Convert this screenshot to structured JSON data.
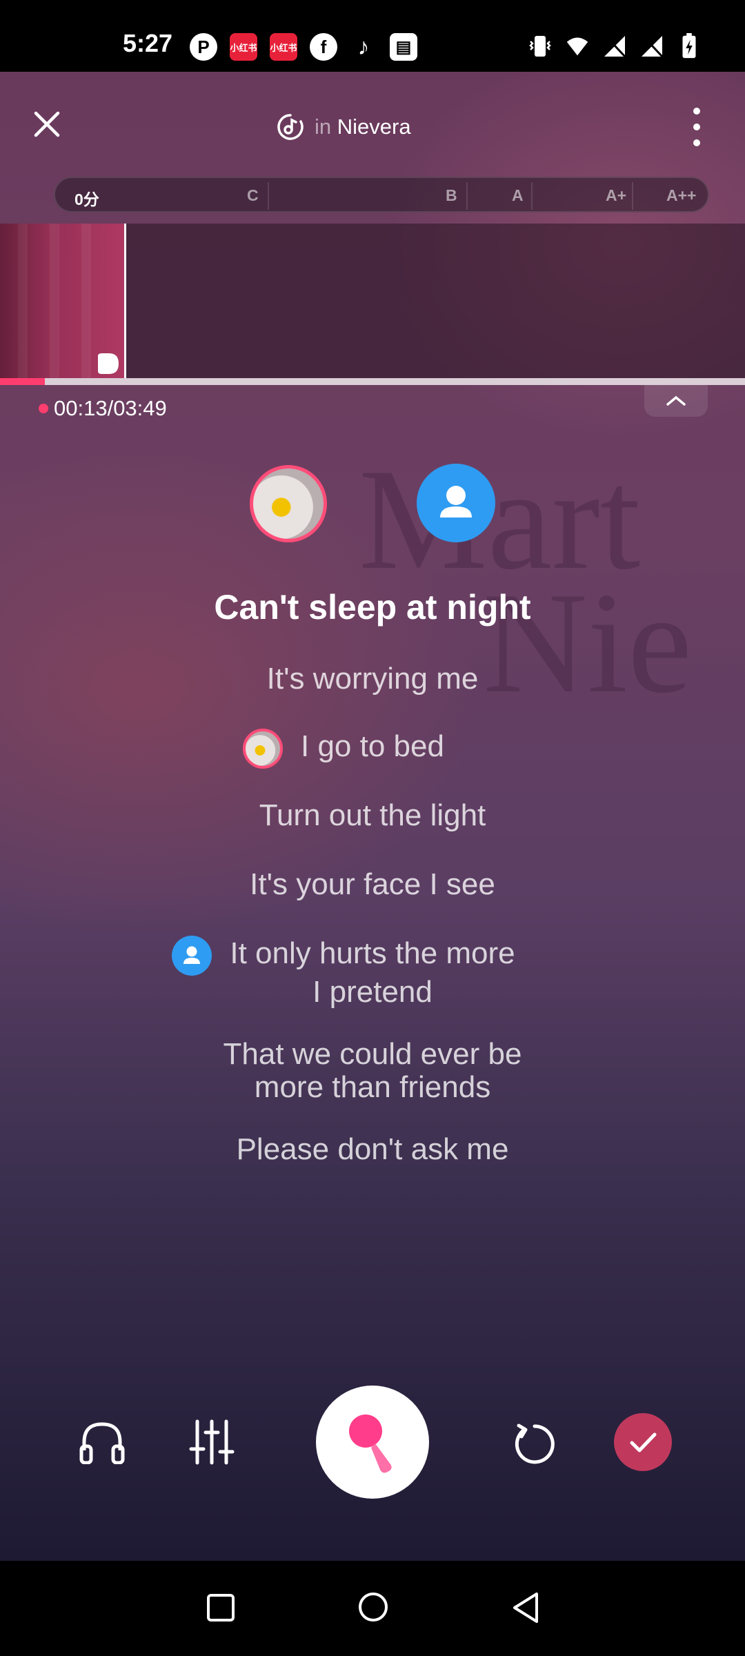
{
  "status_bar": {
    "time": "5:27",
    "apps": [
      "P",
      "小红书",
      "小红书",
      "f",
      "♪",
      "▤"
    ]
  },
  "header": {
    "title_prefix": "in",
    "title": "Nievera"
  },
  "score_bar": {
    "score": "0分",
    "grades": [
      "C",
      "B",
      "A",
      "A+",
      "A++"
    ]
  },
  "playback": {
    "time": "00:13/03:49",
    "progress": 0.06
  },
  "background_text": [
    "Mart",
    "Nie"
  ],
  "lyrics": [
    {
      "text": "Can't sleep at night",
      "current": true,
      "singer": null
    },
    {
      "text": "It's worrying me",
      "current": false,
      "singer": null
    },
    {
      "text": "I go to bed",
      "current": false,
      "singer": "user"
    },
    {
      "text": "Turn out the light",
      "current": false,
      "singer": null
    },
    {
      "text": "It's your face I see",
      "current": false,
      "singer": null
    },
    {
      "text": "It only hurts the more",
      "current": false,
      "singer": "partner"
    },
    {
      "text": "I pretend",
      "current": false,
      "singer": null
    },
    {
      "text": "That we could ever be",
      "current": false,
      "singer": null
    },
    {
      "text": "more than friends",
      "current": false,
      "singer": null
    },
    {
      "text": "Please don't ask me",
      "current": false,
      "singer": null
    }
  ],
  "colors": {
    "accent": "#ff3d6e",
    "partner": "#2e9cf2",
    "done": "#c0395c"
  },
  "icons": {
    "close": "close-icon",
    "music": "music-note-icon",
    "more": "more-vertical-icon",
    "headphones": "headphones-icon",
    "mixer": "equalizer-icon",
    "record": "microphone-icon",
    "restart": "restart-icon",
    "done": "check-icon"
  }
}
